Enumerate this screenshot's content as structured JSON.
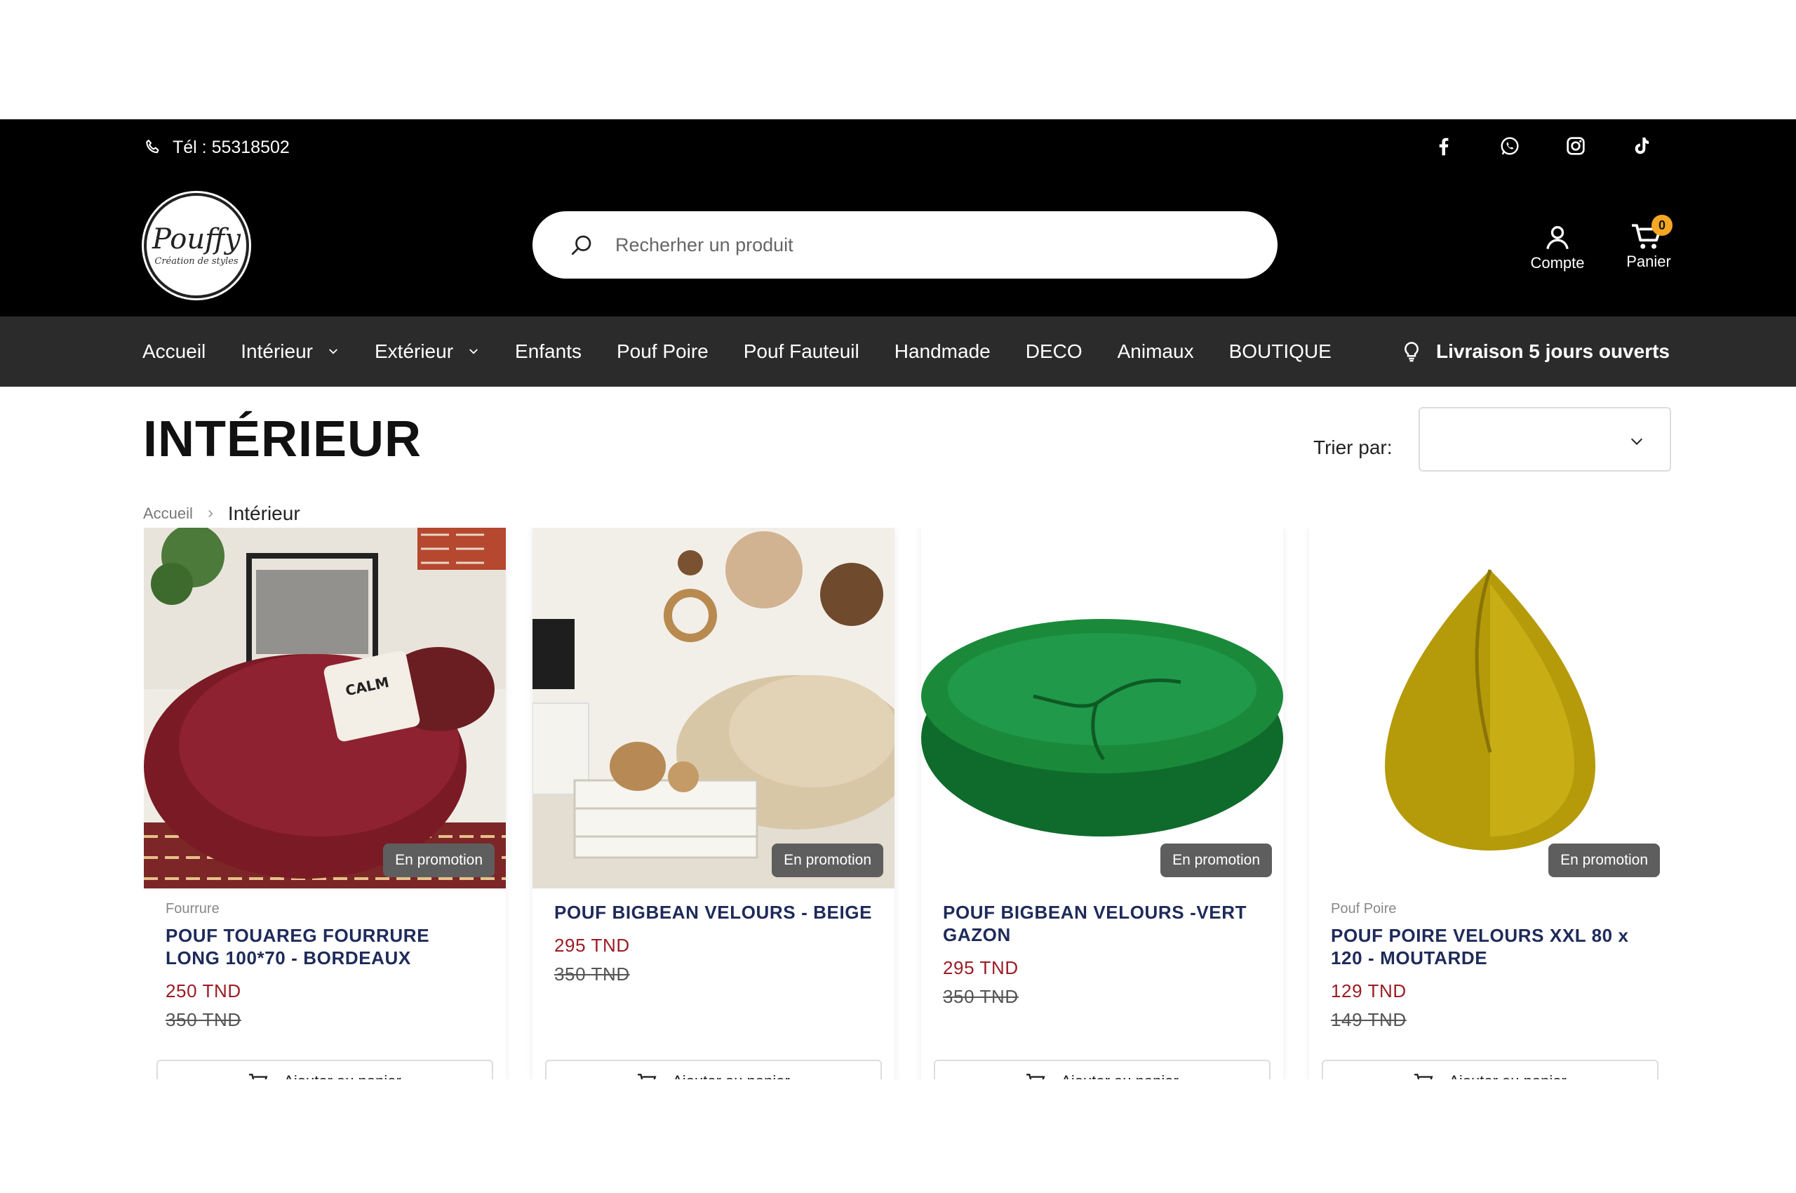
{
  "header": {
    "phone": "Tél : 55318502",
    "logo": {
      "brand": "Pouffy",
      "tagline": "Création de styles"
    },
    "search_placeholder": "Recherher un produit",
    "account_label": "Compte",
    "cart_label": "Panier",
    "cart_count": "0",
    "socials": [
      "facebook-icon",
      "whatsapp-icon",
      "instagram-icon",
      "tiktok-icon"
    ]
  },
  "nav": {
    "items": [
      "Accueil",
      "Intérieur",
      "Extérieur",
      "Enfants",
      "Pouf Poire",
      "Pouf Fauteuil",
      "Handmade",
      "DECO",
      "Animaux",
      "BOUTIQUE"
    ],
    "delivery": "Livraison 5 jours ouverts"
  },
  "page": {
    "title": "INTÉRIEUR",
    "sort_label": "Trier par:",
    "sort_value": "",
    "breadcrumb": {
      "home": "Accueil",
      "current": "Intérieur"
    }
  },
  "products": [
    {
      "category": "Fourrure",
      "name": "POUF TOUAREG FOURRURE LONG 100*70 - BORDEAUX",
      "price": "250 TND",
      "old_price": "350 TND",
      "badge": "En promotion",
      "button": "Ajouter au panier"
    },
    {
      "category": "",
      "name": "POUF BIGBEAN VELOURS - BEIGE",
      "price": "295 TND",
      "old_price": "350 TND",
      "badge": "En promotion",
      "button": "Ajouter au panier"
    },
    {
      "category": "",
      "name": "POUF BIGBEAN VELOURS -VERT GAZON",
      "price": "295 TND",
      "old_price": "350 TND",
      "badge": "En promotion",
      "button": "Ajouter au panier"
    },
    {
      "category": "Pouf Poire",
      "name": "POUF POIRE VELOURS XXL 80 x 120 - MOUTARDE",
      "price": "129 TND",
      "old_price": "149 TND",
      "badge": "En promotion",
      "button": "Ajouter au panier"
    }
  ],
  "colors": {
    "header_bg": "#000000",
    "nav_bg": "#2b2b2b",
    "product_name": "#1e2a5a",
    "price": "#9b1c24",
    "badge_bg": "#5e5e5e",
    "cart_badge": "#f5a623"
  }
}
